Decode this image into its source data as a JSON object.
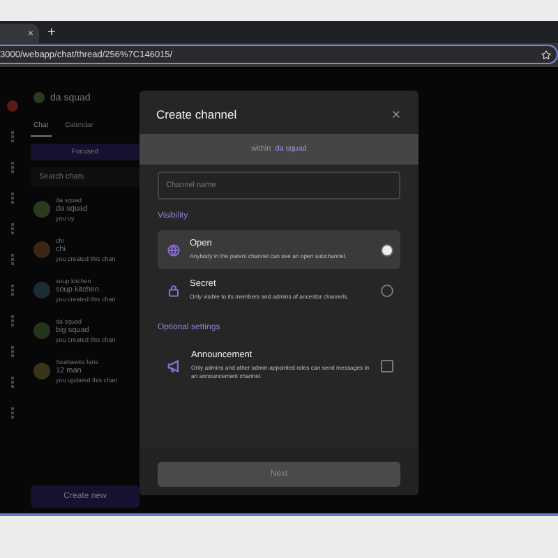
{
  "browser": {
    "tab_close": "×",
    "new_tab": "+",
    "url": "3000/webapp/chat/thread/256%7C146015/"
  },
  "sidebar": {
    "team": "da squad",
    "tabs": [
      {
        "label": "Chat",
        "selected": true
      },
      {
        "label": "Calendar",
        "selected": false
      }
    ],
    "filter": "Focused",
    "search": {
      "placeholder": "Search chats"
    },
    "chats": [
      {
        "group": "da squad",
        "name": "da squad",
        "preview": "you uy",
        "color": "#2a3a1e"
      },
      {
        "group": "chi",
        "name": "chi",
        "preview": "you created this chan",
        "color": "#3a2616"
      },
      {
        "group": "soup kitchen",
        "name": "soup kitchen",
        "preview": "you created this chan",
        "color": "#1a2c34"
      },
      {
        "group": "da squad",
        "name": "big squad",
        "preview": "you created this chan",
        "color": "#24341a"
      },
      {
        "group": "Seahawks fans",
        "name": "12 man",
        "preview": "you updated this chan",
        "color": "#3a3418"
      }
    ],
    "create": "Create new"
  },
  "dialog": {
    "title": "Create channel",
    "within_label": "within",
    "within_team": "da squad",
    "name_field": {
      "placeholder": "Channel name"
    },
    "visibility_heading": "Visibility",
    "options": [
      {
        "kind": "globe",
        "title": "Open",
        "description": "Anybody in the parent channel can see an open subchannel.",
        "selected": true
      },
      {
        "kind": "lock",
        "title": "Secret",
        "description": "Only visible to its members and admins of ancestor channels.",
        "selected": false
      }
    ],
    "settings_heading": "Optional settings",
    "settings": [
      {
        "title": "Announcement",
        "description": "Only admins and other admin-appointed roles can send messages in an announcement channel.",
        "checked": false
      }
    ],
    "next": {
      "label": "Next",
      "disabled": true
    }
  }
}
